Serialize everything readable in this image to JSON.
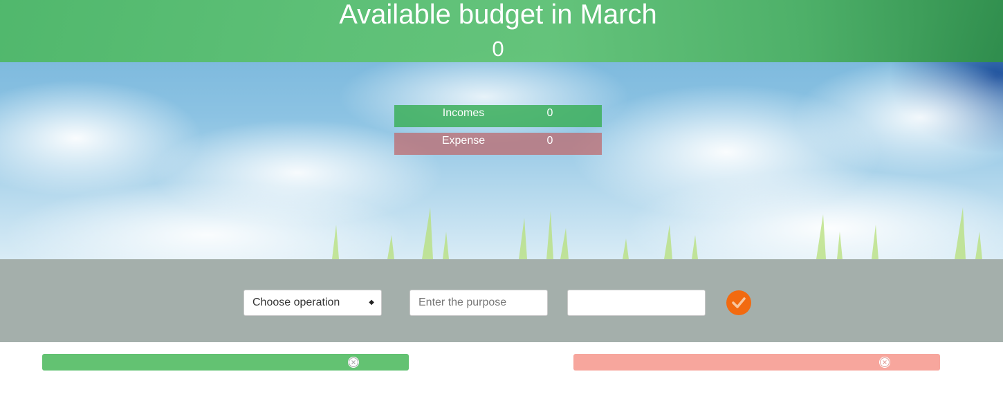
{
  "header": {
    "title": "Available budget in March",
    "budget_value": "0"
  },
  "summary": {
    "incomes": {
      "label": "Incomes",
      "value": "0"
    },
    "expense": {
      "label": "Expense",
      "value": "0"
    }
  },
  "form": {
    "operation_select": {
      "selected": "Choose operation"
    },
    "purpose_input": {
      "placeholder": "Enter the purpose",
      "value": ""
    },
    "amount_input": {
      "placeholder": "",
      "value": ""
    },
    "submit_icon": "check-icon"
  },
  "lists": {
    "income": {
      "delete_icon": "close-circle-icon"
    },
    "expense": {
      "delete_icon": "close-circle-icon"
    }
  },
  "colors": {
    "header_green": "#5dc172",
    "incomes_green": "#3caf5a",
    "expense_red": "#be696e",
    "controls_gray": "#a4afab",
    "submit_orange": "#f26a10",
    "income_bar": "#63c272",
    "expense_bar": "#f7a69d"
  }
}
